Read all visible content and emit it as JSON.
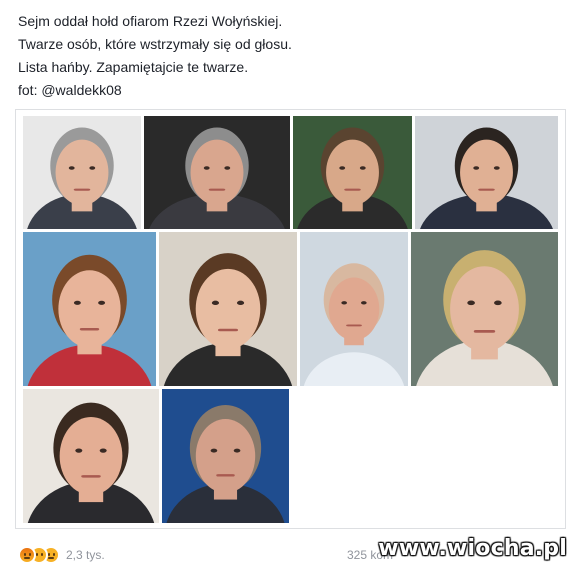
{
  "post": {
    "lines": [
      "Sejm oddał hołd ofiarom Rzezi Wołyńskiej.",
      "Twarze osób, które wstrzymały się od głosu.",
      "Lista hańby. Zapamiętajcie te twarze.",
      "fot: @waldekk08"
    ]
  },
  "gallery": {
    "photos": [
      {
        "name": "photo-1",
        "bg": "#e8e8e8",
        "skin": "#e2b59c",
        "hair": "#9a9a9a",
        "clothes": "#3a3f4a"
      },
      {
        "name": "photo-2",
        "bg": "#2a2a2a",
        "skin": "#d9a68e",
        "hair": "#8d8d8d",
        "clothes": "#3a3a40"
      },
      {
        "name": "photo-3",
        "bg": "#3a5a3a",
        "skin": "#d8a889",
        "hair": "#5a4430",
        "clothes": "#2b2b2b"
      },
      {
        "name": "photo-4",
        "bg": "#cfd3d8",
        "skin": "#e0b094",
        "hair": "#2b2420",
        "clothes": "#2a3040"
      },
      {
        "name": "photo-5",
        "bg": "#6aa0c8",
        "skin": "#e8b49a",
        "hair": "#7a4a2a",
        "clothes": "#c0303a"
      },
      {
        "name": "photo-6",
        "bg": "#d8d2c8",
        "skin": "#e8bda2",
        "hair": "#5a3a24",
        "clothes": "#2a2a2a"
      },
      {
        "name": "photo-7",
        "bg": "#cfd8e0",
        "skin": "#e0a890",
        "hair": "#d8b8a0",
        "clothes": "#e8eef4"
      },
      {
        "name": "photo-8",
        "bg": "#6a7a70",
        "skin": "#e4b8a0",
        "hair": "#c8b070",
        "clothes": "#e6e0d8"
      },
      {
        "name": "photo-9",
        "bg": "#eae6e0",
        "skin": "#e4ae94",
        "hair": "#3a2a20",
        "clothes": "#2a2a2e"
      },
      {
        "name": "photo-10",
        "bg": "#1f4d8f",
        "skin": "#d4a08a",
        "hair": "#8a7a6a",
        "clothes": "#2a2f3a"
      }
    ]
  },
  "reactions": {
    "icons": [
      "angry-icon",
      "wow-icon",
      "sad-icon"
    ],
    "count": "2,3 tys."
  },
  "comments": {
    "label": "325 kom"
  },
  "watermark": {
    "text": "www.wiocha.pl"
  }
}
